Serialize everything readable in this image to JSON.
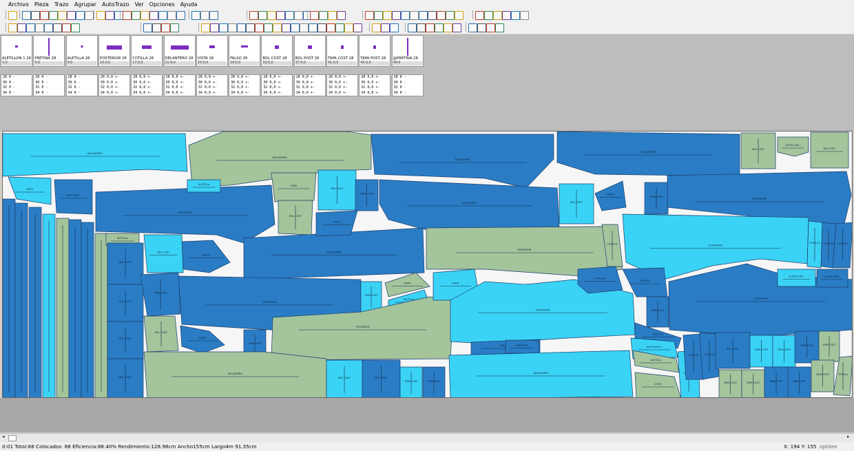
{
  "menu": [
    "Archivo",
    "Pieza",
    "Trazo",
    "Agrupar",
    "AutoTrazo",
    "Ver",
    "Opciones",
    "Ayuda"
  ],
  "pieces": [
    {
      "name": "ALETILLON 1 28",
      "qty": "1:0"
    },
    {
      "name": "PRETINA 28",
      "qty": "5:0"
    },
    {
      "name": "ALETILLA 28",
      "qty": "9:0"
    },
    {
      "name": "POSTERIOR 28",
      "qty": "13:0,0"
    },
    {
      "name": "COTILLA 28",
      "qty": "17:0,0"
    },
    {
      "name": "DELANTERO 28",
      "qty": "21:0,0"
    },
    {
      "name": "VISTA 28",
      "qty": "25:0,0"
    },
    {
      "name": "FALSO 28",
      "qty": "29:0,0"
    },
    {
      "name": "BOL COST 28",
      "qty": "33:0,0"
    },
    {
      "name": "BOL POST 28",
      "qty": "37:0,0"
    },
    {
      "name": "TAPA COST 28",
      "qty": "41:0,0"
    },
    {
      "name": "TAPA POST 28",
      "qty": "45:0,0"
    },
    {
      "name": "@PRETINA 28",
      "qty": "49:0"
    }
  ],
  "size_rows_plain": [
    "28 0 -",
    "30 0 -",
    "32 0 -",
    "34 0 -"
  ],
  "size_rows_mirror": [
    "28 0,0 +-",
    "30 0,0 +-",
    "32 0,0 +-",
    "34 0,0 +-"
  ],
  "labels": {
    "delantero": "DELANTERO",
    "posterior": "POSTERIOR",
    "bolcost": "BOL COST",
    "bolpost": "BOL POST",
    "tapacost": "TAPA COST",
    "tapapost": "TAPA POST",
    "cotilla": "COTILLA",
    "vista": "VISTA",
    "falso": "FALSO",
    "aletilla": "ALETILLA",
    "aletillon": "ALETILLON 1",
    "pretina": "PRETINA"
  },
  "colors": {
    "dark": "#2a7dc4",
    "mid": "#3bd3f5",
    "sage": "#a4c49c",
    "piece_icon": "#7a2dbf"
  },
  "status": {
    "left": "0:01  Total:88  Colocados: 88  Eficiencia:88.40%  Rendimiento:128.98cm  Ancho155cm  Largo4m 91.35cm",
    "coords": "X: 194  Y: 155",
    "brand": "optitex"
  }
}
